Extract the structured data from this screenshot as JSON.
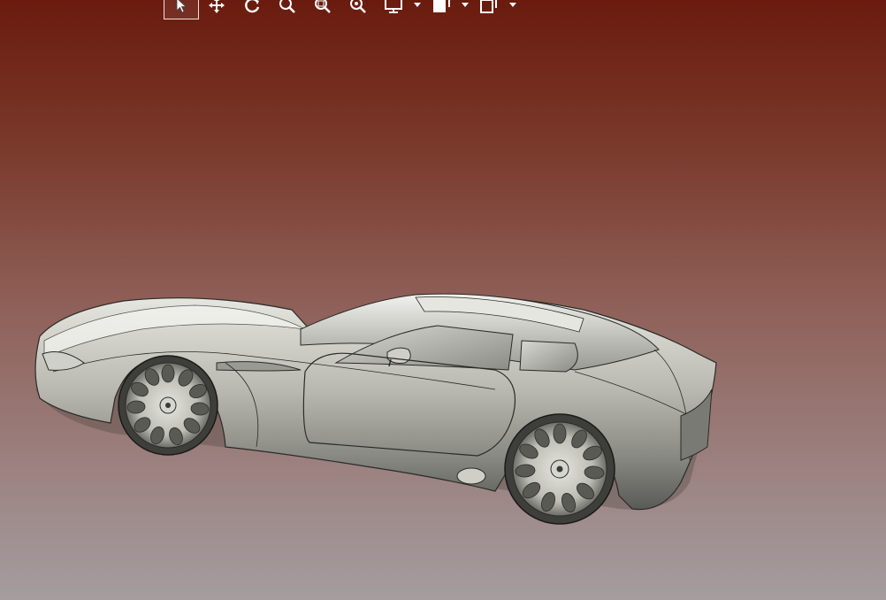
{
  "viewport": {
    "background_top": "#6a1b0e",
    "background_bottom": "#a59d9f",
    "model": "sports-car-3d-model"
  },
  "toolbar": {
    "buttons": [
      {
        "icon": "select-arrow-icon",
        "active": true
      },
      {
        "icon": "pan-icon",
        "active": false
      },
      {
        "icon": "rotate-icon",
        "active": false
      },
      {
        "icon": "zoom-icon",
        "active": false
      },
      {
        "icon": "zoom-window-icon",
        "active": false
      },
      {
        "icon": "zoom-fit-icon",
        "active": false
      },
      {
        "icon": "display-mode-icon",
        "active": false,
        "dropdown": true
      },
      {
        "icon": "view-icon",
        "active": false,
        "dropdown": true
      },
      {
        "icon": "section-icon",
        "active": false,
        "dropdown": true
      }
    ]
  }
}
